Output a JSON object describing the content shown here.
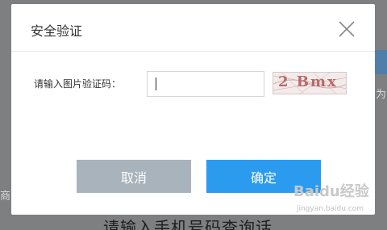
{
  "dialog": {
    "title": "安全验证",
    "label": "请输入图片验证码：",
    "input_value": "",
    "captcha_text": "2 Bmx",
    "cancel_label": "取消",
    "confirm_label": "确定"
  },
  "background": {
    "left_text": "商",
    "right_text": "为",
    "bottom_text": "请输入手机号码查询话"
  },
  "watermark": {
    "logo": "Baidu经验",
    "site": "jingyan.baidu.com"
  },
  "colors": {
    "confirm": "#2b9bf0",
    "cancel": "#a8b3bb",
    "overlay": "#7d7f80"
  }
}
